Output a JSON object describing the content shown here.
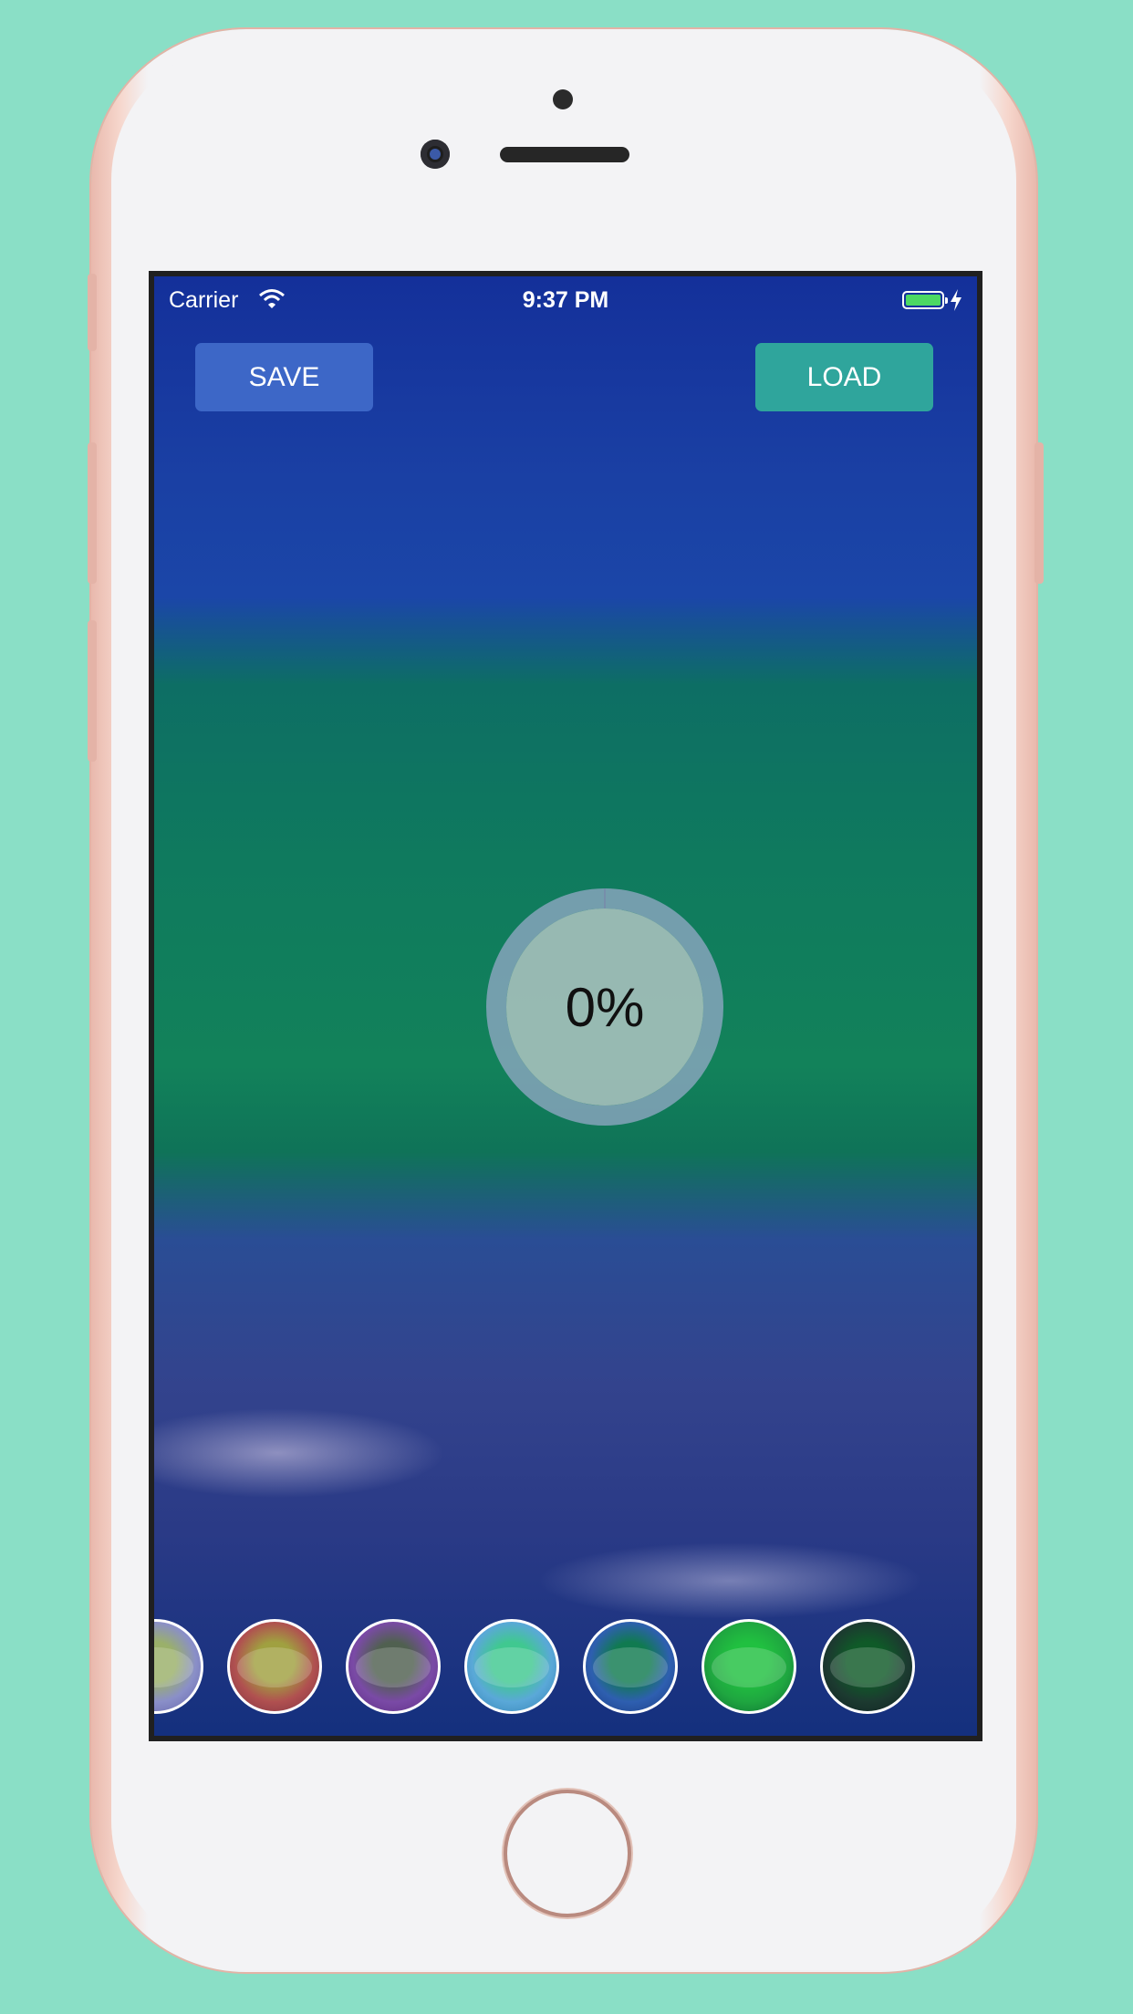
{
  "status_bar": {
    "carrier": "Carrier",
    "time": "9:37 PM",
    "battery_charging": true
  },
  "toolbar": {
    "save_label": "SAVE",
    "load_label": "LOAD"
  },
  "progress": {
    "value": 0,
    "label": "0%"
  },
  "filters": [
    {
      "name": "filter-1",
      "color": "#8a8fc8"
    },
    {
      "name": "filter-2",
      "color": "#b05050"
    },
    {
      "name": "filter-3",
      "color": "#7a4aa6"
    },
    {
      "name": "filter-4",
      "color": "#5aa8d8"
    },
    {
      "name": "filter-5",
      "color": "#2e5fb0"
    },
    {
      "name": "filter-6",
      "color": "#1fa640"
    },
    {
      "name": "filter-7",
      "color": "#1c3a30"
    }
  ],
  "colors": {
    "background": "#8adfc6",
    "save_button": "#3d67c7",
    "load_button": "#2fa59c",
    "battery": "#4cd964"
  }
}
